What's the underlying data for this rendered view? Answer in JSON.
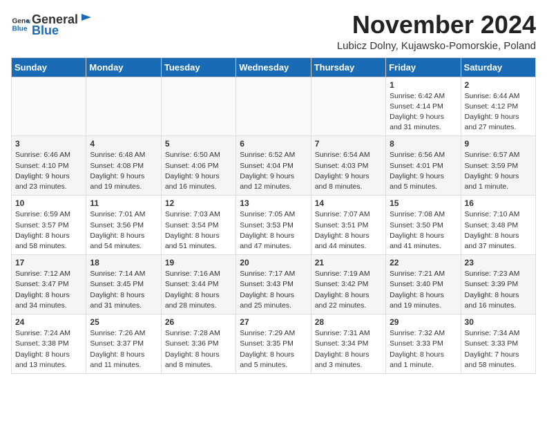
{
  "header": {
    "logo_general": "General",
    "logo_blue": "Blue",
    "month_year": "November 2024",
    "location": "Lubicz Dolny, Kujawsko-Pomorskie, Poland"
  },
  "days_of_week": [
    "Sunday",
    "Monday",
    "Tuesday",
    "Wednesday",
    "Thursday",
    "Friday",
    "Saturday"
  ],
  "weeks": [
    [
      {
        "day": "",
        "info": ""
      },
      {
        "day": "",
        "info": ""
      },
      {
        "day": "",
        "info": ""
      },
      {
        "day": "",
        "info": ""
      },
      {
        "day": "",
        "info": ""
      },
      {
        "day": "1",
        "info": "Sunrise: 6:42 AM\nSunset: 4:14 PM\nDaylight: 9 hours and 31 minutes."
      },
      {
        "day": "2",
        "info": "Sunrise: 6:44 AM\nSunset: 4:12 PM\nDaylight: 9 hours and 27 minutes."
      }
    ],
    [
      {
        "day": "3",
        "info": "Sunrise: 6:46 AM\nSunset: 4:10 PM\nDaylight: 9 hours and 23 minutes."
      },
      {
        "day": "4",
        "info": "Sunrise: 6:48 AM\nSunset: 4:08 PM\nDaylight: 9 hours and 19 minutes."
      },
      {
        "day": "5",
        "info": "Sunrise: 6:50 AM\nSunset: 4:06 PM\nDaylight: 9 hours and 16 minutes."
      },
      {
        "day": "6",
        "info": "Sunrise: 6:52 AM\nSunset: 4:04 PM\nDaylight: 9 hours and 12 minutes."
      },
      {
        "day": "7",
        "info": "Sunrise: 6:54 AM\nSunset: 4:03 PM\nDaylight: 9 hours and 8 minutes."
      },
      {
        "day": "8",
        "info": "Sunrise: 6:56 AM\nSunset: 4:01 PM\nDaylight: 9 hours and 5 minutes."
      },
      {
        "day": "9",
        "info": "Sunrise: 6:57 AM\nSunset: 3:59 PM\nDaylight: 9 hours and 1 minute."
      }
    ],
    [
      {
        "day": "10",
        "info": "Sunrise: 6:59 AM\nSunset: 3:57 PM\nDaylight: 8 hours and 58 minutes."
      },
      {
        "day": "11",
        "info": "Sunrise: 7:01 AM\nSunset: 3:56 PM\nDaylight: 8 hours and 54 minutes."
      },
      {
        "day": "12",
        "info": "Sunrise: 7:03 AM\nSunset: 3:54 PM\nDaylight: 8 hours and 51 minutes."
      },
      {
        "day": "13",
        "info": "Sunrise: 7:05 AM\nSunset: 3:53 PM\nDaylight: 8 hours and 47 minutes."
      },
      {
        "day": "14",
        "info": "Sunrise: 7:07 AM\nSunset: 3:51 PM\nDaylight: 8 hours and 44 minutes."
      },
      {
        "day": "15",
        "info": "Sunrise: 7:08 AM\nSunset: 3:50 PM\nDaylight: 8 hours and 41 minutes."
      },
      {
        "day": "16",
        "info": "Sunrise: 7:10 AM\nSunset: 3:48 PM\nDaylight: 8 hours and 37 minutes."
      }
    ],
    [
      {
        "day": "17",
        "info": "Sunrise: 7:12 AM\nSunset: 3:47 PM\nDaylight: 8 hours and 34 minutes."
      },
      {
        "day": "18",
        "info": "Sunrise: 7:14 AM\nSunset: 3:45 PM\nDaylight: 8 hours and 31 minutes."
      },
      {
        "day": "19",
        "info": "Sunrise: 7:16 AM\nSunset: 3:44 PM\nDaylight: 8 hours and 28 minutes."
      },
      {
        "day": "20",
        "info": "Sunrise: 7:17 AM\nSunset: 3:43 PM\nDaylight: 8 hours and 25 minutes."
      },
      {
        "day": "21",
        "info": "Sunrise: 7:19 AM\nSunset: 3:42 PM\nDaylight: 8 hours and 22 minutes."
      },
      {
        "day": "22",
        "info": "Sunrise: 7:21 AM\nSunset: 3:40 PM\nDaylight: 8 hours and 19 minutes."
      },
      {
        "day": "23",
        "info": "Sunrise: 7:23 AM\nSunset: 3:39 PM\nDaylight: 8 hours and 16 minutes."
      }
    ],
    [
      {
        "day": "24",
        "info": "Sunrise: 7:24 AM\nSunset: 3:38 PM\nDaylight: 8 hours and 13 minutes."
      },
      {
        "day": "25",
        "info": "Sunrise: 7:26 AM\nSunset: 3:37 PM\nDaylight: 8 hours and 11 minutes."
      },
      {
        "day": "26",
        "info": "Sunrise: 7:28 AM\nSunset: 3:36 PM\nDaylight: 8 hours and 8 minutes."
      },
      {
        "day": "27",
        "info": "Sunrise: 7:29 AM\nSunset: 3:35 PM\nDaylight: 8 hours and 5 minutes."
      },
      {
        "day": "28",
        "info": "Sunrise: 7:31 AM\nSunset: 3:34 PM\nDaylight: 8 hours and 3 minutes."
      },
      {
        "day": "29",
        "info": "Sunrise: 7:32 AM\nSunset: 3:33 PM\nDaylight: 8 hours and 1 minute."
      },
      {
        "day": "30",
        "info": "Sunrise: 7:34 AM\nSunset: 3:33 PM\nDaylight: 7 hours and 58 minutes."
      }
    ]
  ]
}
